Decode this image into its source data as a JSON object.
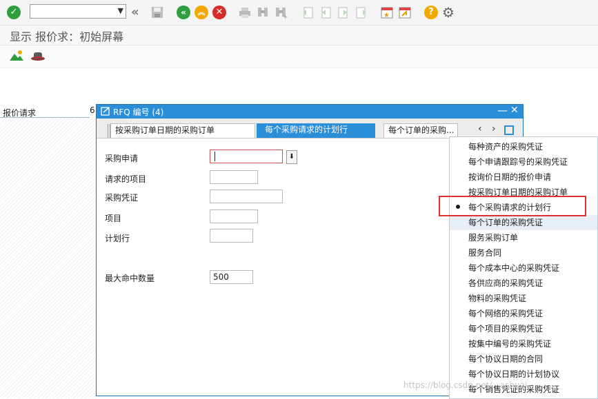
{
  "toolbar": {
    "command_field_value": "",
    "icons": [
      "enter-icon",
      "command-field",
      "back-double-icon",
      "save-icon",
      "back-icon",
      "exit-icon",
      "cancel-icon",
      "print-icon",
      "find-icon",
      "find-next-icon",
      "first-page-icon",
      "prev-page-icon",
      "next-page-icon",
      "last-page-icon",
      "new-session-icon",
      "shortcut-icon",
      "help-icon",
      "settings-icon"
    ]
  },
  "screen": {
    "title": "显示 报价求：初始屏幕"
  },
  "background": {
    "field_label": "报价请求",
    "field_value": "6"
  },
  "dialog": {
    "title": "RFQ 编号 (4)",
    "tabs": [
      "按采购订单日期的采购订单",
      "每个采购请求的计划行",
      "每个订单的采购..."
    ],
    "active_tab_index": 1,
    "fields": [
      {
        "label": "采购申请",
        "value": ""
      },
      {
        "label": "请求的项目",
        "value": ""
      },
      {
        "label": "采购凭证",
        "value": ""
      },
      {
        "label": "项目",
        "value": ""
      },
      {
        "label": "计划行",
        "value": ""
      }
    ],
    "max_hits_label": "最大命中数量",
    "max_hits_value": "500"
  },
  "menu": {
    "items": [
      "每种资产的采购凭证",
      "每个申请跟踪号的采购凭证",
      "按询价日期的报价申请",
      "按采购订单日期的采购订单",
      "每个采购请求的计划行",
      "每个订单的采购凭证",
      "服务采购订单",
      "服务合同",
      "每个成本中心的采购凭证",
      "各供应商的采购凭证",
      "物料的采购凭证",
      "每个网络的采购凭证",
      "每个项目的采购凭证",
      "按集中编号的采购凭证",
      "每个协议日期的合同",
      "每个协议日期的计划协议",
      "每个销售凭证的采购凭证"
    ],
    "selected_index": 4,
    "hover_index": 5
  },
  "watermark": "https://blog.csdn.net/...ashuai",
  "colors": {
    "accent": "#2a8fd8",
    "highlight": "#e03131"
  }
}
